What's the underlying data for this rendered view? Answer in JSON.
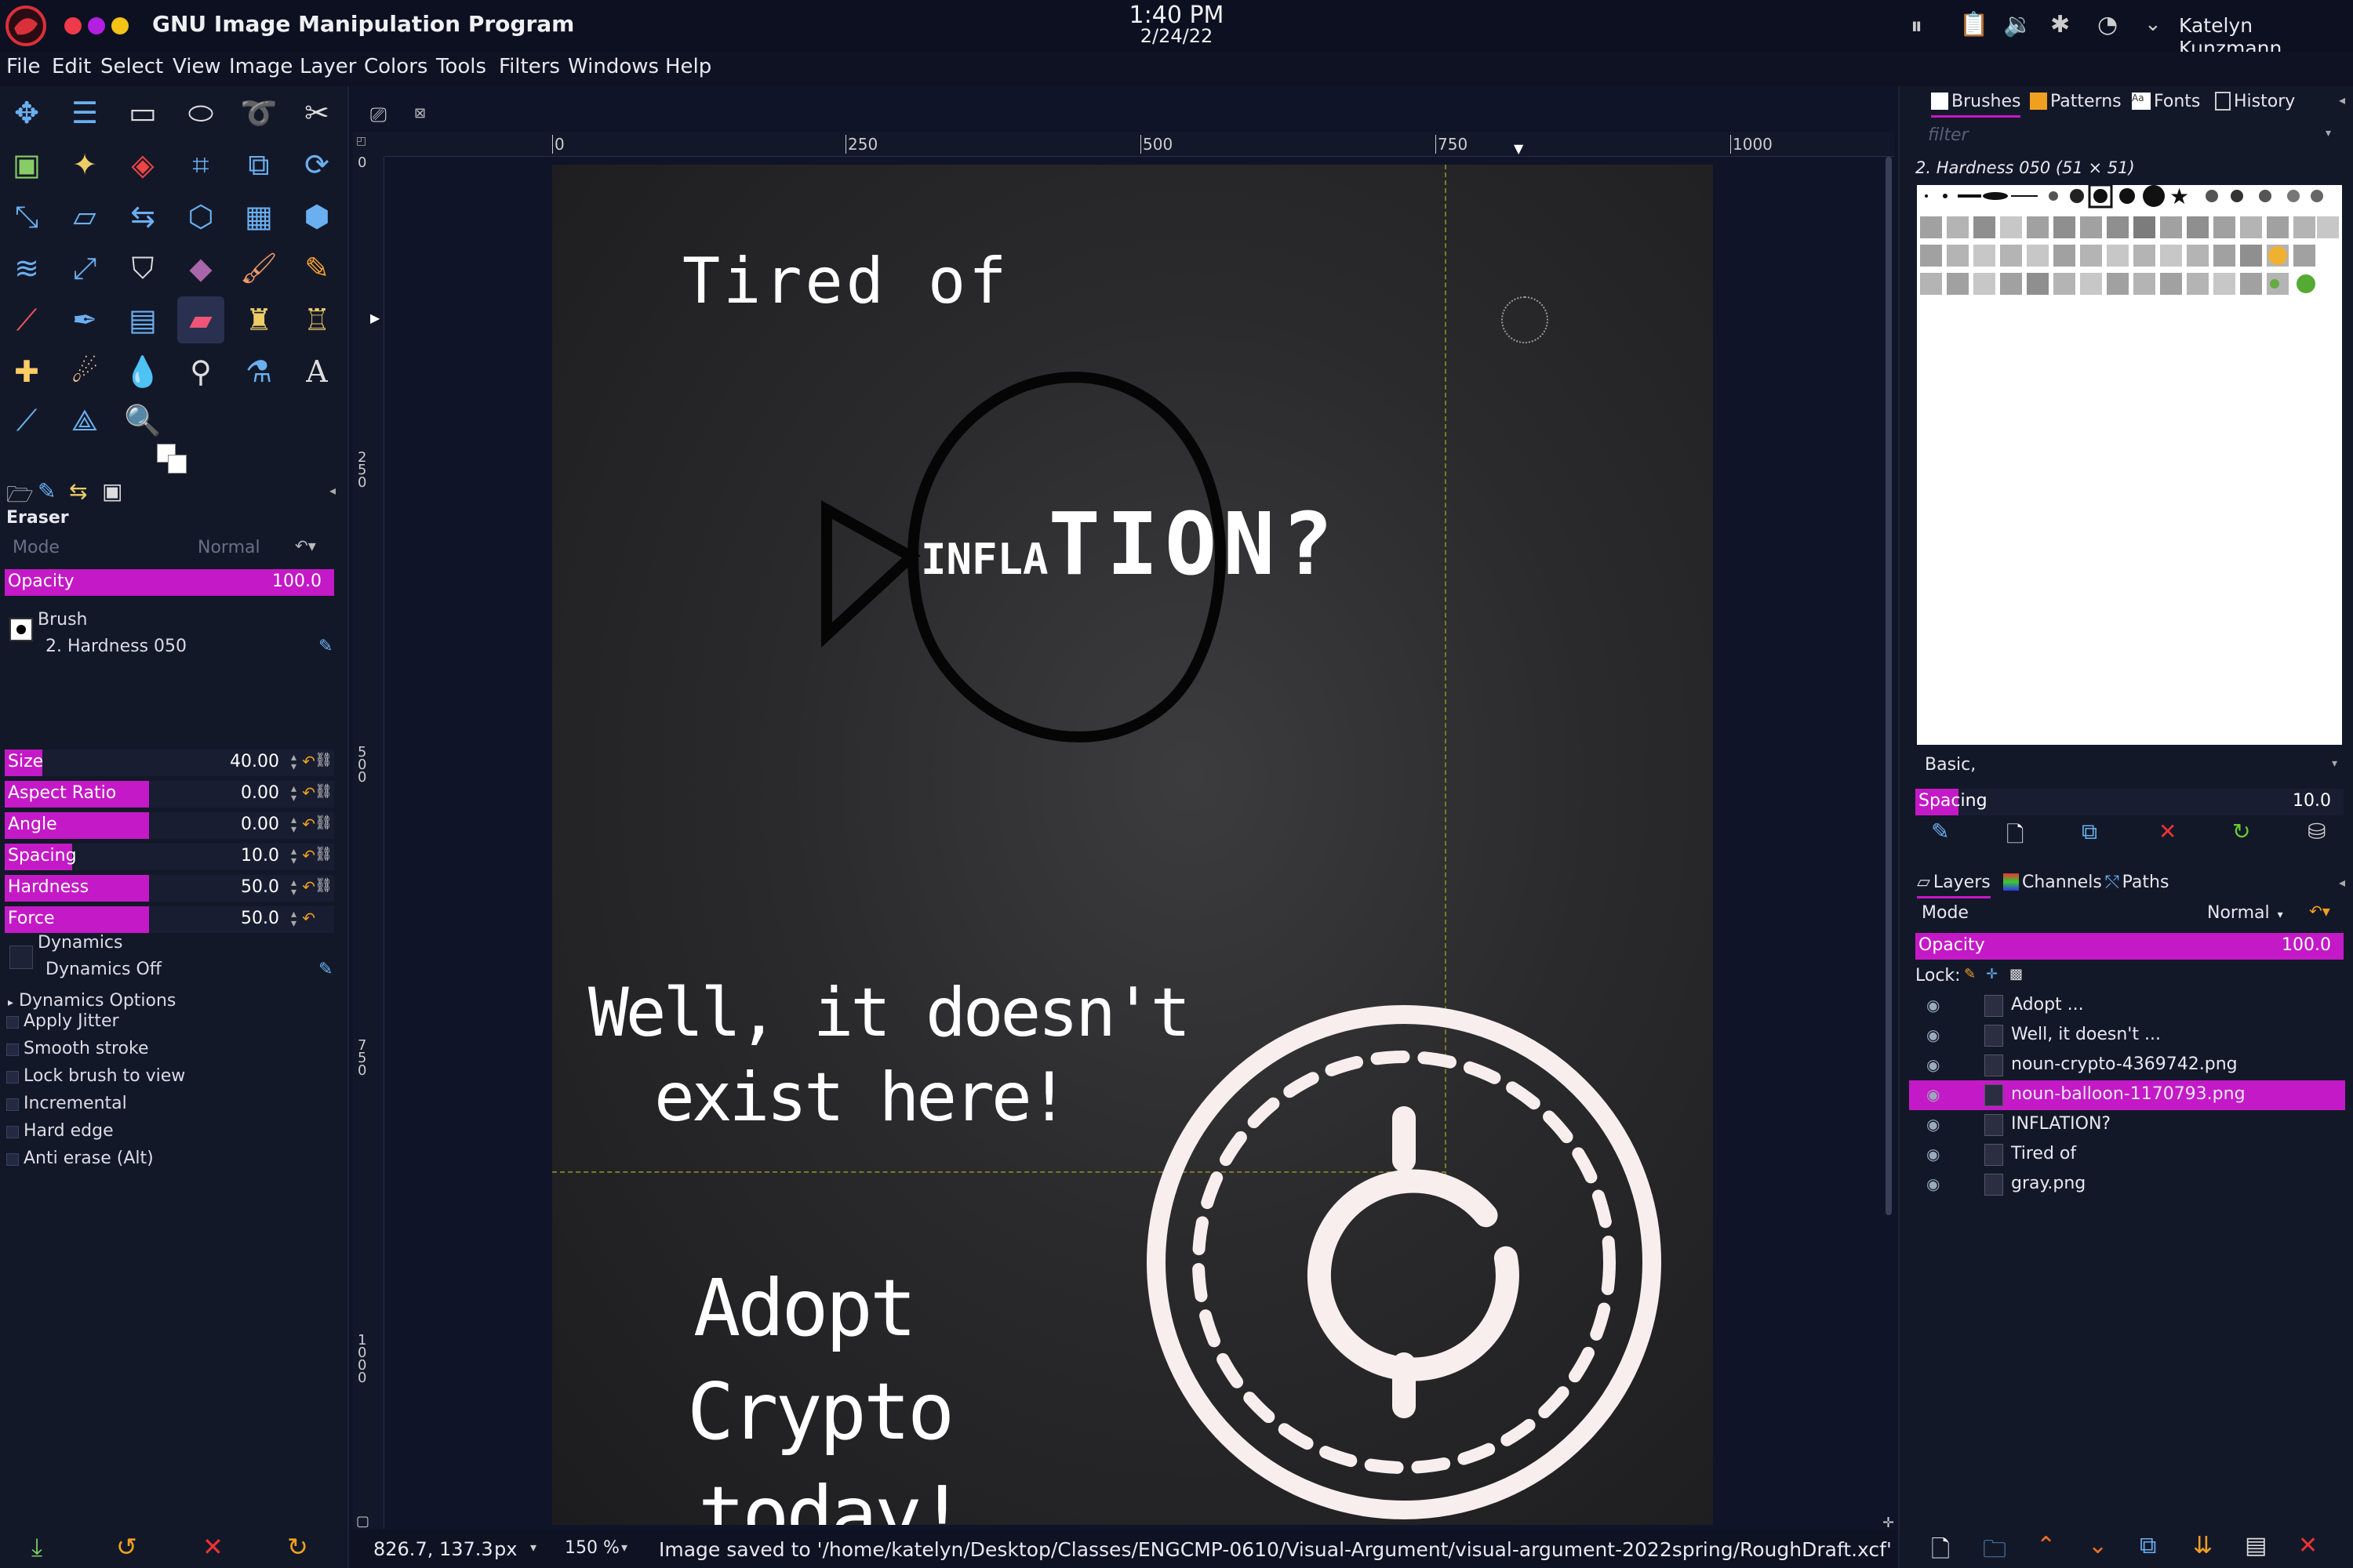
{
  "app": {
    "title": "GNU Image Manipulation Program",
    "time": "1:40 PM",
    "date": "2/24/22",
    "user": "Katelyn Kunzmann"
  },
  "menu": [
    "File",
    "Edit",
    "Select",
    "View",
    "Image",
    "Layer",
    "Colors",
    "Tools",
    "Filters",
    "Windows",
    "Help"
  ],
  "tool_options": {
    "title": "Eraser",
    "mode_label": "Mode",
    "mode_value": "Normal",
    "opacity_label": "Opacity",
    "opacity_value": "100.0",
    "opacity_fraction": 1.0,
    "brush_label": "Brush",
    "brush_value": "2. Hardness 050",
    "sliders": [
      {
        "label": "Size",
        "value": "40.00",
        "fraction": 0.1
      },
      {
        "label": "Aspect Ratio",
        "value": "0.00",
        "fraction": 0.5
      },
      {
        "label": "Angle",
        "value": "0.00",
        "fraction": 0.5
      },
      {
        "label": "Spacing",
        "value": "10.0",
        "fraction": 0.1
      },
      {
        "label": "Hardness",
        "value": "50.0",
        "fraction": 0.5
      },
      {
        "label": "Force",
        "value": "50.0",
        "fraction": 0.5
      }
    ],
    "dynamics_label": "Dynamics",
    "dynamics_value": "Dynamics Off",
    "dynamics_options": "Dynamics Options",
    "checkboxes": [
      "Apply Jitter",
      "Smooth stroke",
      "Lock brush to view",
      "Incremental",
      "Hard edge",
      "Anti erase  (Alt)"
    ]
  },
  "rulers": {
    "top": [
      "0",
      "250",
      "500",
      "750",
      "1000"
    ],
    "left": [
      "0",
      "250",
      "500",
      "750",
      "1000"
    ]
  },
  "poster": {
    "line1": "Tired of",
    "inflation_small": "INFLA",
    "inflation_large": "TION?",
    "line2a": "Well, it doesn't",
    "line2b": "exist here!",
    "line3a": "Adopt",
    "line3b": "Crypto",
    "line3c": "today!"
  },
  "status": {
    "coords": "826.7, 137.3",
    "unit": "px",
    "zoom": "150 %",
    "message": "Image saved to '/home/katelyn/Desktop/Classes/ENGCMP-0610/Visual-Argument/visual-argument-2022spring/RoughDraft.xcf'"
  },
  "brushes_panel": {
    "tabs": [
      "Brushes",
      "Patterns",
      "Fonts",
      "History"
    ],
    "filter_placeholder": "filter",
    "selected": "2. Hardness 050 (51 × 51)",
    "tag": "Basic,",
    "spacing_label": "Spacing",
    "spacing_value": "10.0"
  },
  "layers_panel": {
    "tabs": [
      "Layers",
      "Channels",
      "Paths"
    ],
    "mode_label": "Mode",
    "mode_value": "Normal",
    "opacity_label": "Opacity",
    "opacity_value": "100.0",
    "lock_label": "Lock:",
    "layers": [
      {
        "name": "Adopt  ...",
        "selected": false
      },
      {
        "name": "Well, it doesn't ...",
        "selected": false
      },
      {
        "name": "noun-crypto-4369742.png",
        "selected": false
      },
      {
        "name": "noun-balloon-1170793.png",
        "selected": true
      },
      {
        "name": "INFLATION?",
        "selected": false
      },
      {
        "name": "Tired of",
        "selected": false
      },
      {
        "name": "gray.png",
        "selected": false
      }
    ]
  },
  "colors": {
    "accent": "#c419c6",
    "bg": "#131829"
  }
}
